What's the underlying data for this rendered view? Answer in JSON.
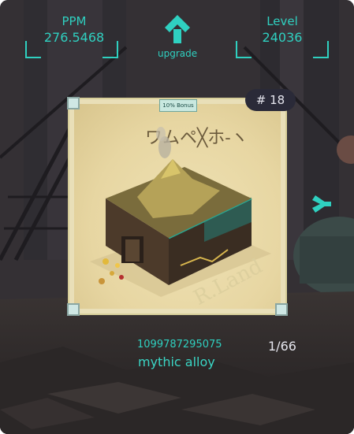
{
  "stats": {
    "ppm": {
      "label": "PPM",
      "value": "276.5468"
    },
    "level": {
      "label": "Level",
      "value": "24036"
    }
  },
  "upgrade": {
    "label": "upgrade",
    "icon": "up-chevron-icon"
  },
  "card": {
    "rank": "# 18",
    "bonus": "10% Bonus",
    "glyph_title": "ワムペ╳ホ-ヽ",
    "watermark": "R.Land"
  },
  "item": {
    "id": "1099787295075",
    "name": "mythic alloy",
    "count": "1/66"
  },
  "icons": {
    "next": "chevron-right-icon"
  },
  "colors": {
    "accent": "#2fd0c0",
    "badge_bg": "#2a2a38"
  }
}
